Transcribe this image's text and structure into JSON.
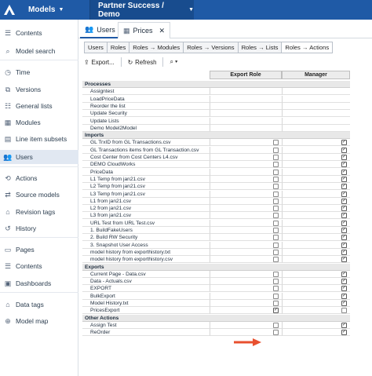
{
  "topbar": {
    "models_label": "Models",
    "breadcrumb": "Partner Success / Demo"
  },
  "sidebar": [
    {
      "label": "Contents",
      "icon": "contents-icon",
      "glyph": "☰"
    },
    {
      "label": "Model search",
      "icon": "search-icon",
      "glyph": "⌕"
    },
    {
      "label": "Time",
      "icon": "clock-icon",
      "glyph": "◷"
    },
    {
      "label": "Versions",
      "icon": "versions-icon",
      "glyph": "⧉"
    },
    {
      "label": "General lists",
      "icon": "list-icon",
      "glyph": "☷"
    },
    {
      "label": "Modules",
      "icon": "modules-icon",
      "glyph": "▦"
    },
    {
      "label": "Line item subsets",
      "icon": "subsets-icon",
      "glyph": "▤"
    },
    {
      "label": "Users",
      "icon": "users-icon",
      "glyph": "👥"
    },
    {
      "label": "Actions",
      "icon": "actions-icon",
      "glyph": "⟲"
    },
    {
      "label": "Source models",
      "icon": "source-models-icon",
      "glyph": "⇄"
    },
    {
      "label": "Revision tags",
      "icon": "tag-icon",
      "glyph": "⌂"
    },
    {
      "label": "History",
      "icon": "history-icon",
      "glyph": "↺"
    },
    {
      "label": "Pages",
      "icon": "pages-icon",
      "glyph": "▭"
    },
    {
      "label": "Contents",
      "icon": "contents-icon",
      "glyph": "☰"
    },
    {
      "label": "Dashboards",
      "icon": "dashboard-icon",
      "glyph": "▣"
    },
    {
      "label": "Data tags",
      "icon": "data-tag-icon",
      "glyph": "⌂"
    },
    {
      "label": "Model map",
      "icon": "model-map-icon",
      "glyph": "⊕"
    }
  ],
  "tabs": [
    {
      "label": "Users",
      "icon": "users-icon"
    },
    {
      "label": "Prices",
      "icon": "grid-icon",
      "close": "✕"
    }
  ],
  "subtabs": [
    "Users",
    "Roles",
    "Roles → Modules",
    "Roles → Versions",
    "Roles → Lists",
    "Roles → Actions"
  ],
  "toolbar": {
    "export": "Export...",
    "refresh": "Refresh",
    "search": "⌕ ▾"
  },
  "columns": [
    "Export Role",
    "Manager"
  ],
  "rows": [
    {
      "label": "Processes",
      "section": true
    },
    {
      "label": "Assigntest",
      "export": null,
      "manager": null
    },
    {
      "label": "LoadPriceData",
      "export": null,
      "manager": null
    },
    {
      "label": "Reorder the list",
      "export": null,
      "manager": null
    },
    {
      "label": "Update Security",
      "export": null,
      "manager": null
    },
    {
      "label": "Update Lists",
      "export": null,
      "manager": null
    },
    {
      "label": "Demo Model2Model",
      "export": null,
      "manager": null
    },
    {
      "label": "Imports",
      "section": true
    },
    {
      "label": "GL TrxID from GL Transactions.csv",
      "export": false,
      "manager": true
    },
    {
      "label": "GL Transactions items from GL Transaction.csv",
      "export": false,
      "manager": true
    },
    {
      "label": "Cost Center from Cost Centers L4.csv",
      "export": false,
      "manager": true
    },
    {
      "label": "DEMO CloudWorks",
      "export": false,
      "manager": true
    },
    {
      "label": "PriceData",
      "export": false,
      "manager": true
    },
    {
      "label": "L1 Temp from jan21.csv",
      "export": false,
      "manager": true
    },
    {
      "label": "L2 Temp from jan21.csv",
      "export": false,
      "manager": true
    },
    {
      "label": "L3 Temp from jan21.csv",
      "export": false,
      "manager": true
    },
    {
      "label": "L1 from jan21.csv",
      "export": false,
      "manager": true
    },
    {
      "label": "L2 from jan21.csv",
      "export": false,
      "manager": true
    },
    {
      "label": "L3 from jan21.csv",
      "export": false,
      "manager": true
    },
    {
      "label": "URL Test from URL Test.csv",
      "export": false,
      "manager": true
    },
    {
      "label": "1. BuildFakeUsers",
      "export": false,
      "manager": true
    },
    {
      "label": "2. Build RW Security",
      "export": false,
      "manager": true
    },
    {
      "label": "3. Snapshot User Access",
      "export": false,
      "manager": true
    },
    {
      "label": "model history from exporthistory.txt",
      "export": false,
      "manager": true
    },
    {
      "label": "model history from exporthistory.csv",
      "export": false,
      "manager": true
    },
    {
      "label": "Exports",
      "section": true
    },
    {
      "label": "Current Page - Data.csv",
      "export": false,
      "manager": true
    },
    {
      "label": "Data - Actuals.csv",
      "export": false,
      "manager": true
    },
    {
      "label": "EXPORT",
      "export": false,
      "manager": true
    },
    {
      "label": "BulkExport",
      "export": false,
      "manager": true
    },
    {
      "label": "Model History.txt",
      "export": false,
      "manager": true
    },
    {
      "label": "PricesExport",
      "export": true,
      "manager": false
    },
    {
      "label": "Other Actions",
      "section": true
    },
    {
      "label": "Assign Test",
      "export": false,
      "manager": true
    },
    {
      "label": "ReOrder",
      "export": false,
      "manager": true
    }
  ],
  "colors": {
    "brand": "#1f5aa6",
    "arrow": "#e8502f"
  }
}
